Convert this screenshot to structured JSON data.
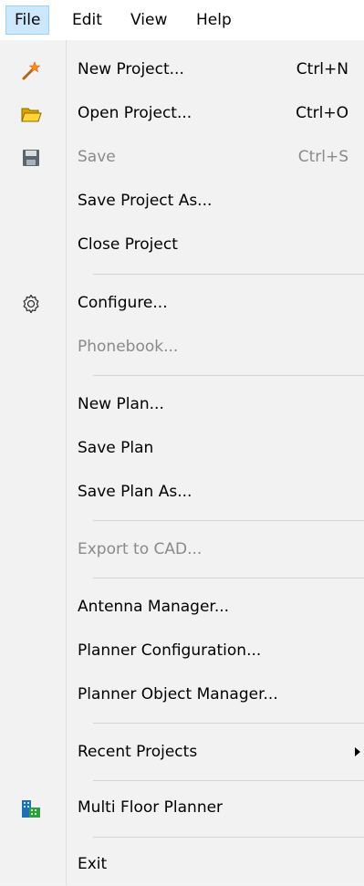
{
  "menubar": {
    "items": [
      {
        "label": "File"
      },
      {
        "label": "Edit"
      },
      {
        "label": "View"
      },
      {
        "label": "Help"
      }
    ]
  },
  "file_menu": {
    "new_project": {
      "label": "New Project...",
      "shortcut": "Ctrl+N"
    },
    "open_project": {
      "label": "Open Project...",
      "shortcut": "Ctrl+O"
    },
    "save": {
      "label": "Save",
      "shortcut": "Ctrl+S"
    },
    "save_project_as": {
      "label": "Save Project As..."
    },
    "close_project": {
      "label": "Close Project"
    },
    "configure": {
      "label": "Configure..."
    },
    "phonebook": {
      "label": "Phonebook..."
    },
    "new_plan": {
      "label": "New Plan..."
    },
    "save_plan": {
      "label": "Save Plan"
    },
    "save_plan_as": {
      "label": "Save Plan As..."
    },
    "export_to_cad": {
      "label": "Export to CAD..."
    },
    "antenna_manager": {
      "label": "Antenna Manager..."
    },
    "planner_configuration": {
      "label": "Planner Configuration..."
    },
    "planner_object_manager": {
      "label": "Planner Object Manager..."
    },
    "recent_projects": {
      "label": "Recent Projects"
    },
    "multi_floor_planner": {
      "label": "Multi Floor Planner"
    },
    "exit": {
      "label": "Exit"
    }
  },
  "icons": {
    "new_project": "magic-wand-icon",
    "open_project": "open-folder-icon",
    "save": "floppy-disk-icon",
    "configure": "gear-icon",
    "recent_projects": "submenu-arrow-icon",
    "multi_floor_planner": "building-floors-icon"
  },
  "colors": {
    "menubar_bg": "#ffffff",
    "active_menu_bg": "#cce8ff",
    "active_menu_border": "#99d1ff",
    "dropdown_bg": "#f2f2f2",
    "disabled_text": "#8a8a8a",
    "separator": "#d4d4d4"
  }
}
